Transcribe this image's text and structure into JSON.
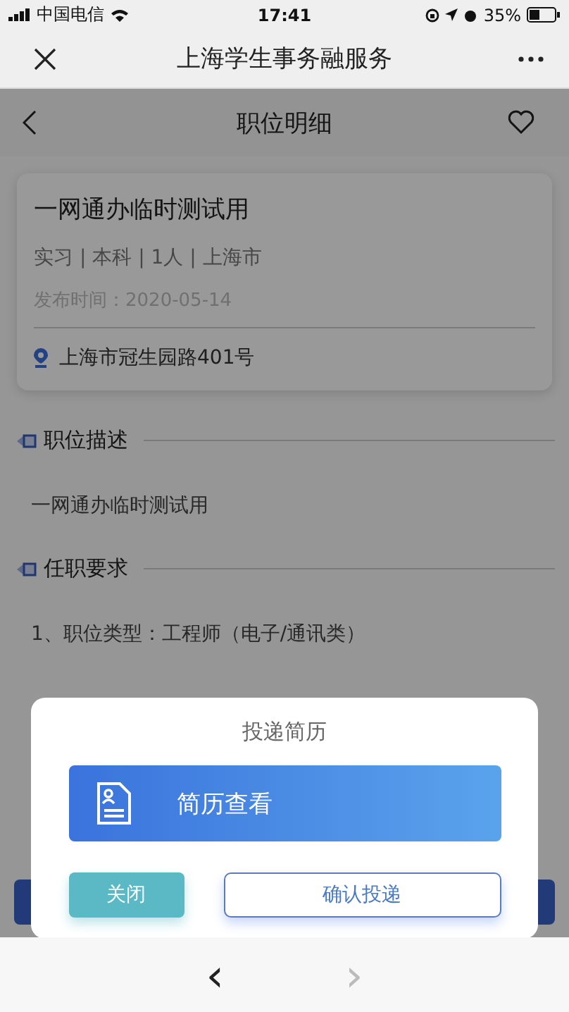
{
  "status_bar": {
    "carrier": "中国电信",
    "time": "17:41",
    "battery": "35%"
  },
  "title_bar": {
    "title": "上海学生事务融服务"
  },
  "page_header": {
    "title": "职位明细"
  },
  "job_card": {
    "title": "一网通办临时测试用",
    "meta": "实习 | 本科 | 1人 | 上海市",
    "posted": "发布时间：2020-05-14",
    "address": "上海市冠生园路401号"
  },
  "sections": [
    {
      "heading": "职位描述",
      "lines": [
        "一网通办临时测试用"
      ]
    },
    {
      "heading": "任职要求",
      "lines": [
        "1、职位类型：工程师（电子/通讯类）"
      ]
    }
  ],
  "dialog": {
    "title": "投递简历",
    "resume_button": "简历查看",
    "buttons": [
      {
        "label": "关闭",
        "kind": "close"
      },
      {
        "label": "确认投递",
        "kind": "confirm"
      }
    ]
  },
  "browser_nav": [
    {
      "label": "‹",
      "disabled": false
    },
    {
      "label": "›",
      "disabled": true
    }
  ]
}
